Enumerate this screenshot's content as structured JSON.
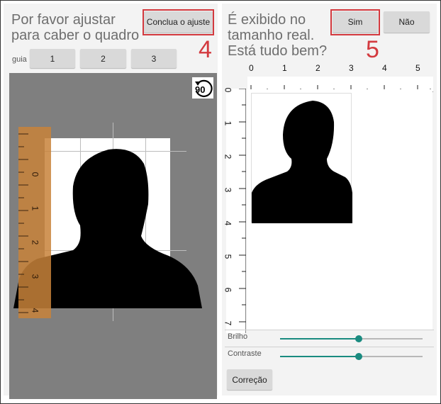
{
  "left": {
    "instruction": "Por favor ajustar\npara caber o quadro",
    "finish_button": "Conclua o ajuste",
    "guide_label": "guia",
    "guide_buttons": [
      "1",
      "2",
      "3"
    ],
    "rotate_label": "90",
    "step_number": "4",
    "ruler_numbers": [
      "0",
      "1",
      "2",
      "3",
      "4"
    ]
  },
  "right": {
    "question": "É exibido no\ntamanho real.\nEstá tudo bem?",
    "yes_button": "Sim",
    "no_button": "Não",
    "step_number": "5",
    "ruler_top_numbers": [
      "0",
      "1",
      "2",
      "3",
      "4",
      "5"
    ],
    "ruler_left_numbers": [
      "0",
      "1",
      "2",
      "3",
      "4",
      "5",
      "6",
      "7"
    ],
    "brightness_label": "Brilho",
    "brightness_value": 0.55,
    "contrast_label": "Contraste",
    "contrast_value": 0.55,
    "correction_button": "Correção"
  },
  "colors": {
    "highlight": "#d33a3f",
    "slider": "#1a8b80",
    "button": "#d9d9d9"
  }
}
